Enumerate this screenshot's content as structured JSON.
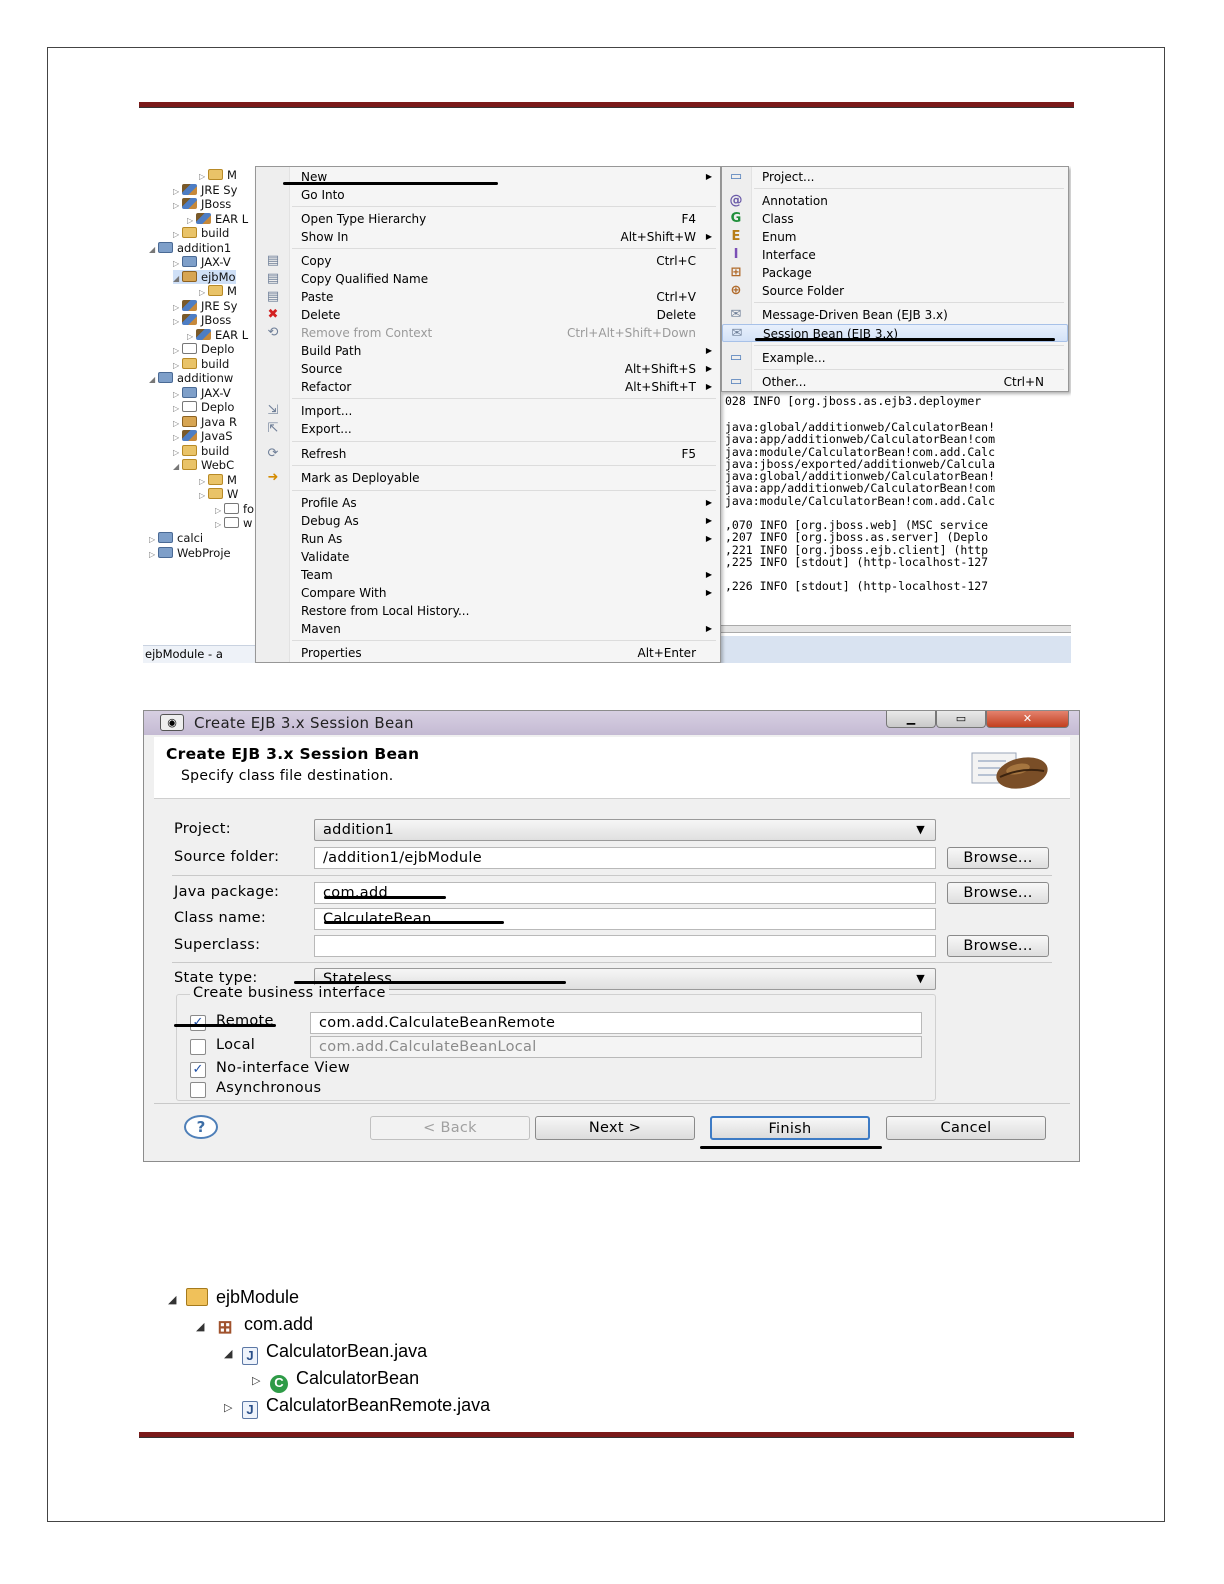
{
  "explorer": {
    "rows": [
      "M",
      "JRE Sy",
      "JBoss",
      "EAR L",
      "build",
      "addition1",
      "JAX-V",
      "ejbMo",
      "M",
      "JRE Sy",
      "JBoss",
      "EAR L",
      "Deplo",
      "build",
      "additionw",
      "JAX-V",
      "Deplo",
      "Java R",
      "JavaS",
      "build",
      "WebC",
      "M",
      "W",
      "fo",
      "w",
      "calci",
      "WebProje"
    ],
    "status": "ejbModule - a"
  },
  "context_menu": {
    "items": [
      {
        "label": "New",
        "shortcut": "",
        "submenu": true
      },
      {
        "label": "Go Into",
        "shortcut": ""
      },
      {
        "label": "Open Type Hierarchy",
        "shortcut": "F4"
      },
      {
        "label": "Show In",
        "shortcut": "Alt+Shift+W",
        "submenu": true
      },
      {
        "label": "Copy",
        "shortcut": "Ctrl+C"
      },
      {
        "label": "Copy Qualified Name",
        "shortcut": ""
      },
      {
        "label": "Paste",
        "shortcut": "Ctrl+V"
      },
      {
        "label": "Delete",
        "shortcut": "Delete"
      },
      {
        "label": "Remove from Context",
        "shortcut": "Ctrl+Alt+Shift+Down"
      },
      {
        "label": "Build Path",
        "shortcut": "",
        "submenu": true
      },
      {
        "label": "Source",
        "shortcut": "Alt+Shift+S",
        "submenu": true
      },
      {
        "label": "Refactor",
        "shortcut": "Alt+Shift+T",
        "submenu": true
      },
      {
        "label": "Import...",
        "shortcut": ""
      },
      {
        "label": "Export...",
        "shortcut": ""
      },
      {
        "label": "Refresh",
        "shortcut": "F5"
      },
      {
        "label": "Mark as Deployable",
        "shortcut": ""
      },
      {
        "label": "Profile As",
        "shortcut": "",
        "submenu": true
      },
      {
        "label": "Debug As",
        "shortcut": "",
        "submenu": true
      },
      {
        "label": "Run As",
        "shortcut": "",
        "submenu": true
      },
      {
        "label": "Validate",
        "shortcut": ""
      },
      {
        "label": "Team",
        "shortcut": "",
        "submenu": true
      },
      {
        "label": "Compare With",
        "shortcut": "",
        "submenu": true
      },
      {
        "label": "Restore from Local History...",
        "shortcut": ""
      },
      {
        "label": "Maven",
        "shortcut": "",
        "submenu": true
      },
      {
        "label": "Properties",
        "shortcut": "Alt+Enter"
      }
    ]
  },
  "new_submenu": {
    "items": [
      {
        "label": "Project...",
        "shortcut": ""
      },
      {
        "label": "Annotation",
        "shortcut": ""
      },
      {
        "label": "Class",
        "shortcut": ""
      },
      {
        "label": "Enum",
        "shortcut": ""
      },
      {
        "label": "Interface",
        "shortcut": ""
      },
      {
        "label": "Package",
        "shortcut": ""
      },
      {
        "label": "Source Folder",
        "shortcut": ""
      },
      {
        "label": "Message-Driven Bean (EJB 3.x)",
        "shortcut": ""
      },
      {
        "label": "Session Bean (EJB 3.x)",
        "shortcut": "",
        "highlighted": true
      },
      {
        "label": "Example...",
        "shortcut": ""
      },
      {
        "label": "Other...",
        "shortcut": "Ctrl+N"
      }
    ]
  },
  "console": {
    "lines": [
      "028 INFO  [org.jboss.as.ejb3.deploymer",
      "java:global/additionweb/CalculatorBean!",
      "java:app/additionweb/CalculatorBean!com",
      "java:module/CalculatorBean!com.add.Calc",
      "java:jboss/exported/additionweb/Calcula",
      "java:global/additionweb/CalculatorBean!",
      "java:app/additionweb/CalculatorBean!com",
      "java:module/CalculatorBean!com.add.Calc",
      ",070 INFO  [org.jboss.web] (MSC service",
      ",207 INFO  [org.jboss.as.server] (Deplo",
      ",221 INFO  [org.jboss.ejb.client] (http",
      ",225 INFO  [stdout] (http-localhost-127",
      ",226 INFO  [stdout] (http-localhost-127"
    ]
  },
  "dialog": {
    "window_title": "Create EJB 3.x Session Bean",
    "heading": "Create EJB 3.x Session Bean",
    "subheading": "Specify class file destination.",
    "project_label": "Project:",
    "project_value": "addition1",
    "source_folder_label": "Source folder:",
    "source_folder_value": "/addition1/ejbModule",
    "java_package_label": "Java package:",
    "java_package_value": "com.add",
    "class_name_label": "Class name:",
    "class_name_value": "CalculateBean",
    "superclass_label": "Superclass:",
    "superclass_value": "",
    "state_type_label": "State type:",
    "state_type_value": "Stateless",
    "browse_label": "Browse...",
    "group_title": "Create business interface",
    "remote_label": "Remote",
    "remote_checked": true,
    "remote_value": "com.add.CalculateBeanRemote",
    "local_label": "Local",
    "local_checked": false,
    "local_value": "com.add.CalculateBeanLocal",
    "no_interface_label": "No-interface View",
    "no_interface_checked": true,
    "async_label": "Asynchronous",
    "async_checked": false,
    "help_label": "?",
    "back_label": "< Back",
    "next_label": "Next >",
    "finish_label": "Finish",
    "cancel_label": "Cancel"
  },
  "project_tree": {
    "items": [
      {
        "label": "ejbModule",
        "icon": "source-folder-icon"
      },
      {
        "label": "com.add",
        "icon": "package-icon"
      },
      {
        "label": "CalculatorBean.java",
        "icon": "java-file-icon"
      },
      {
        "label": "CalculatorBean",
        "icon": "class-icon"
      },
      {
        "label": "CalculatorBeanRemote.java",
        "icon": "java-file-icon"
      }
    ]
  }
}
